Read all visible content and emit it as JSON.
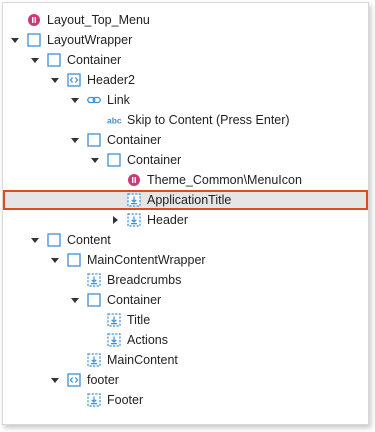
{
  "colors": {
    "accent": "#3d8fd9",
    "block": "#c93c7a",
    "selection_outline": "#e04a1f",
    "selection_fill": "#e5e5e5"
  },
  "tree": [
    {
      "label": "Layout_Top_Menu",
      "icon": "block-icon",
      "toggle": "none",
      "depth": 0
    },
    {
      "label": "LayoutWrapper",
      "icon": "container-icon",
      "toggle": "expanded",
      "depth": 0
    },
    {
      "label": "Container",
      "icon": "container-icon",
      "toggle": "expanded",
      "depth": 1
    },
    {
      "label": "Header2",
      "icon": "code-icon",
      "toggle": "expanded",
      "depth": 2
    },
    {
      "label": "Link",
      "icon": "link-icon",
      "toggle": "expanded",
      "depth": 3
    },
    {
      "label": "Skip to Content (Press Enter)",
      "icon": "text-icon",
      "toggle": "none",
      "depth": 4
    },
    {
      "label": "Container",
      "icon": "container-icon",
      "toggle": "expanded",
      "depth": 3
    },
    {
      "label": "Container",
      "icon": "container-icon",
      "toggle": "expanded",
      "depth": 4
    },
    {
      "label": "Theme_Common\\MenuIcon",
      "icon": "block-icon",
      "toggle": "none",
      "depth": 5
    },
    {
      "label": "ApplicationTitle",
      "icon": "placeholder-icon",
      "toggle": "none",
      "depth": 5,
      "selected": true
    },
    {
      "label": "Header",
      "icon": "placeholder-icon",
      "toggle": "collapsed",
      "depth": 5
    },
    {
      "label": "Content",
      "icon": "container-icon",
      "toggle": "expanded",
      "depth": 1
    },
    {
      "label": "MainContentWrapper",
      "icon": "container-icon",
      "toggle": "expanded",
      "depth": 2
    },
    {
      "label": "Breadcrumbs",
      "icon": "placeholder-icon",
      "toggle": "none",
      "depth": 3
    },
    {
      "label": "Container",
      "icon": "container-icon",
      "toggle": "expanded",
      "depth": 3
    },
    {
      "label": "Title",
      "icon": "placeholder-icon",
      "toggle": "none",
      "depth": 4
    },
    {
      "label": "Actions",
      "icon": "placeholder-icon",
      "toggle": "none",
      "depth": 4
    },
    {
      "label": "MainContent",
      "icon": "placeholder-icon",
      "toggle": "none",
      "depth": 3
    },
    {
      "label": "footer",
      "icon": "code-icon",
      "toggle": "expanded",
      "depth": 2
    },
    {
      "label": "Footer",
      "icon": "placeholder-icon",
      "toggle": "none",
      "depth": 3
    }
  ]
}
